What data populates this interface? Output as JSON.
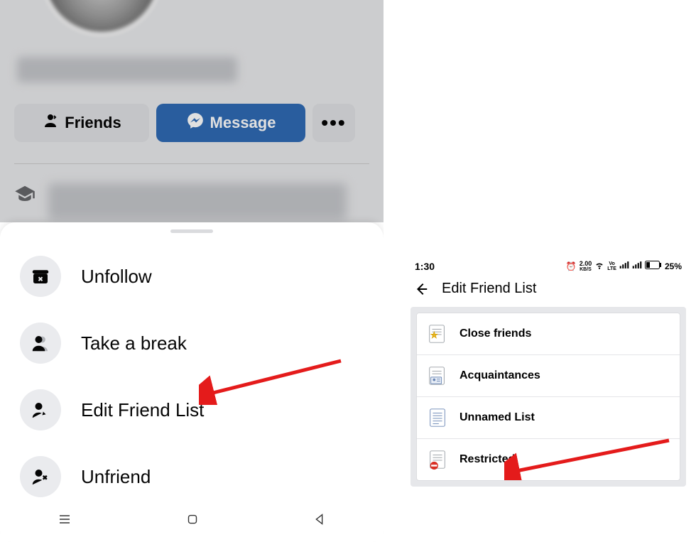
{
  "profile": {
    "friends_label": "Friends",
    "message_label": "Message",
    "more_label": "•••"
  },
  "sheet": {
    "items": [
      {
        "id": "unfollow",
        "label": "Unfollow",
        "icon": "archive-x-icon"
      },
      {
        "id": "take-break",
        "label": "Take a break",
        "icon": "person-shadow-icon"
      },
      {
        "id": "edit-friend-list",
        "label": "Edit Friend List",
        "icon": "person-pencil-icon"
      },
      {
        "id": "unfriend",
        "label": "Unfriend",
        "icon": "person-x-icon"
      }
    ]
  },
  "right": {
    "status": {
      "time": "1:30",
      "net_speed": "2.00",
      "net_unit": "KB/S",
      "lte": "LTE",
      "battery_pct": "25%"
    },
    "header": {
      "title": "Edit Friend List"
    },
    "list": [
      {
        "id": "close-friends",
        "label": "Close friends",
        "icon": "star-list-icon"
      },
      {
        "id": "acquaintances",
        "label": "Acquaintances",
        "icon": "id-list-icon"
      },
      {
        "id": "unnamed-list",
        "label": "Unnamed List",
        "icon": "plain-list-icon"
      },
      {
        "id": "restricted",
        "label": "Restricted",
        "icon": "prohibit-list-icon"
      }
    ]
  }
}
